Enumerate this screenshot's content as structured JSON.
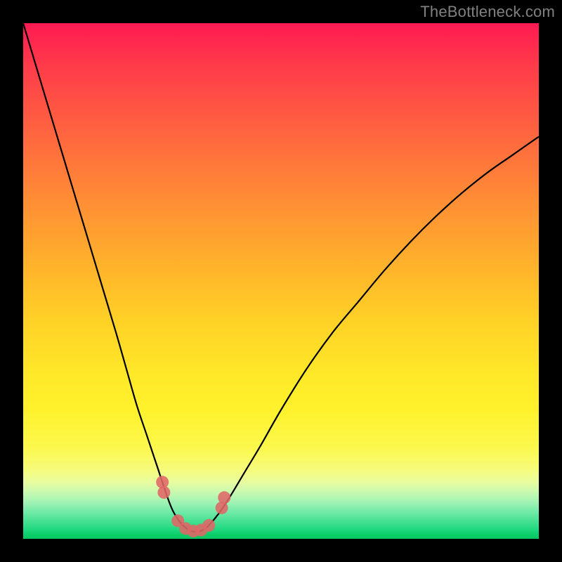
{
  "watermark": "TheBottleneck.com",
  "colors": {
    "frame": "#000000",
    "curve": "#000000",
    "markers": "#e06666"
  },
  "chart_data": {
    "type": "line",
    "title": "",
    "xlabel": "",
    "ylabel": "",
    "xlim": [
      0,
      100
    ],
    "ylim": [
      0,
      100
    ],
    "series": [
      {
        "name": "bottleneck-curve",
        "x": [
          0,
          3,
          6,
          9,
          12,
          15,
          18,
          20,
          22,
          24,
          26,
          28,
          29,
          30,
          31,
          32,
          33,
          34,
          35,
          36,
          38,
          40,
          43,
          46,
          50,
          55,
          60,
          65,
          70,
          75,
          80,
          85,
          90,
          95,
          100
        ],
        "y": [
          100,
          90,
          80,
          70,
          60,
          50,
          40,
          33,
          26,
          20,
          14,
          8,
          5.5,
          3.8,
          2.6,
          1.8,
          1.4,
          1.4,
          1.8,
          2.6,
          5.0,
          8.0,
          13,
          18,
          25,
          33,
          40,
          46,
          52,
          57.5,
          62.5,
          67,
          71,
          74.5,
          78
        ],
        "color": "#000000"
      }
    ],
    "markers": [
      {
        "x": 27.0,
        "y": 11.0
      },
      {
        "x": 27.3,
        "y": 9.0
      },
      {
        "x": 30.0,
        "y": 3.5
      },
      {
        "x": 31.5,
        "y": 2.0
      },
      {
        "x": 33.0,
        "y": 1.5
      },
      {
        "x": 34.5,
        "y": 1.7
      },
      {
        "x": 36.0,
        "y": 2.6
      },
      {
        "x": 38.5,
        "y": 6.0
      },
      {
        "x": 39.0,
        "y": 8.0
      }
    ]
  }
}
